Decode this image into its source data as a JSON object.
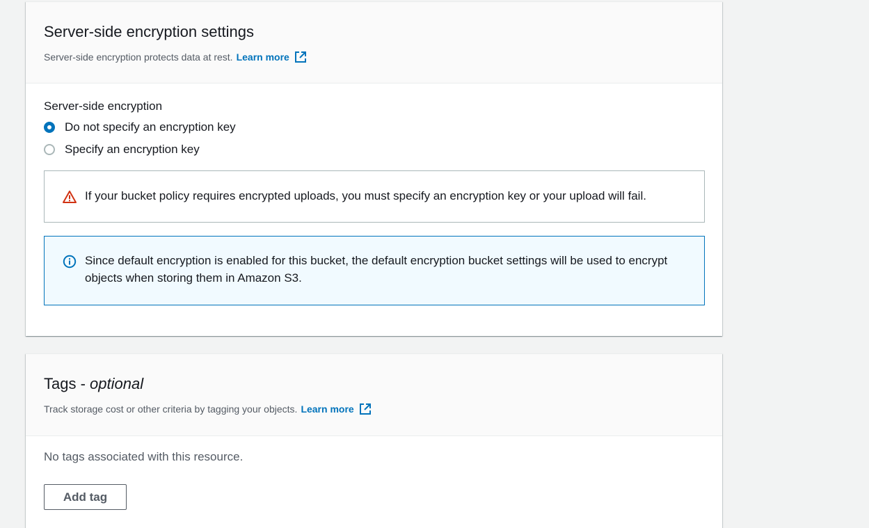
{
  "encryption": {
    "title": "Server-side encryption settings",
    "description": "Server-side encryption protects data at rest.",
    "learn_more": "Learn more",
    "field_label": "Server-side encryption",
    "options": [
      {
        "label": "Do not specify an encryption key",
        "selected": true
      },
      {
        "label": "Specify an encryption key",
        "selected": false
      }
    ],
    "warning": "If your bucket policy requires encrypted uploads, you must specify an encryption key or your upload will fail.",
    "info": "Since default encryption is enabled for this bucket, the default encryption bucket settings will be used to encrypt objects when storing them in Amazon S3."
  },
  "tags": {
    "title_main": "Tags - ",
    "title_optional": "optional",
    "description": "Track storage cost or other criteria by tagging your objects.",
    "learn_more": "Learn more",
    "empty_text": "No tags associated with this resource.",
    "add_button": "Add tag"
  },
  "icons": {
    "external_link": "external-link-icon",
    "warning": "warning-triangle-icon",
    "info": "info-circle-icon"
  },
  "colors": {
    "link": "#0073bb",
    "warning": "#d13212",
    "info_border": "#0073bb",
    "info_bg": "#f1faff"
  }
}
